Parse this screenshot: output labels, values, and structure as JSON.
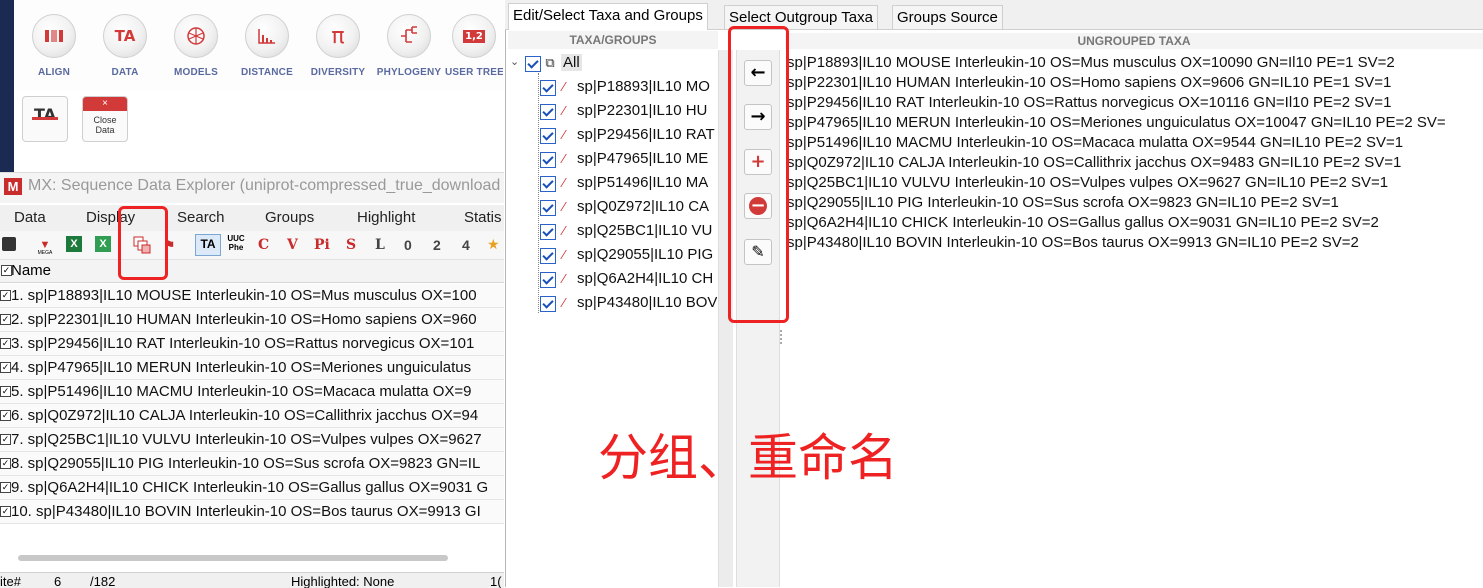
{
  "ribbon": {
    "items": [
      {
        "label": "ALIGN",
        "icon": "align-icon"
      },
      {
        "label": "DATA",
        "icon": "data-icon",
        "glyph": "TA"
      },
      {
        "label": "MODELS",
        "icon": "models-icon"
      },
      {
        "label": "DISTANCE",
        "icon": "distance-icon"
      },
      {
        "label": "DIVERSITY",
        "icon": "diversity-icon",
        "glyph": "π"
      },
      {
        "label": "PHYLOGENY",
        "icon": "phylogeny-icon"
      },
      {
        "label": "USER TREE",
        "icon": "user-tree-icon",
        "glyph": "1,2"
      }
    ],
    "ta_button_glyph": "TA",
    "close_data_label": "Close Data",
    "close_data_top": "×"
  },
  "sequence_explorer": {
    "title": "MX: Sequence Data Explorer (uniprot-compressed_true_download",
    "menu": [
      "Data",
      "Display",
      "Search",
      "Groups",
      "Highlight",
      "Statis"
    ],
    "toolbar_letters": [
      "C",
      "V",
      "Pi",
      "S",
      "L",
      "0",
      "2",
      "4"
    ],
    "toolbar_small_labels": {
      "mega": "MEGA",
      "uuc": "UUC Phe",
      "ta": "TA"
    },
    "column_header": "Name",
    "rows": [
      "1. sp|P18893|IL10 MOUSE Interleukin-10 OS=Mus musculus OX=100",
      "2. sp|P22301|IL10 HUMAN Interleukin-10 OS=Homo sapiens OX=960",
      "3. sp|P29456|IL10 RAT Interleukin-10 OS=Rattus norvegicus OX=101",
      "4. sp|P47965|IL10 MERUN Interleukin-10 OS=Meriones unguiculatus",
      "5. sp|P51496|IL10 MACMU Interleukin-10 OS=Macaca mulatta OX=9",
      "6. sp|Q0Z972|IL10 CALJA Interleukin-10 OS=Callithrix jacchus OX=94",
      "7. sp|Q25BC1|IL10 VULVU Interleukin-10 OS=Vulpes vulpes OX=9627",
      "8. sp|Q29055|IL10 PIG Interleukin-10 OS=Sus scrofa OX=9823 GN=IL",
      "9. sp|Q6A2H4|IL10 CHICK Interleukin-10 OS=Gallus gallus OX=9031 G",
      "10. sp|P43480|IL10 BOVIN Interleukin-10 OS=Bos taurus OX=9913 GI"
    ],
    "status": {
      "site_label": "ite#",
      "site_value": "6",
      "site_total": "/182",
      "highlighted": "Highlighted: None",
      "extra": "1("
    }
  },
  "groups_dialog": {
    "tabs": [
      "Edit/Select Taxa and Groups",
      "Select Outgroup Taxa",
      "Groups Source"
    ],
    "taxa_header": "TAXA/GROUPS",
    "ungrouped_header": "UNGROUPED TAXA",
    "tree_root": "All",
    "tree_items": [
      "sp|P18893|IL10 MO",
      "sp|P22301|IL10 HU",
      "sp|P29456|IL10 RAT",
      "sp|P47965|IL10 ME",
      "sp|P51496|IL10 MA",
      "sp|Q0Z972|IL10 CA",
      "sp|Q25BC1|IL10 VU",
      "sp|Q29055|IL10 PIG",
      "sp|Q6A2H4|IL10 CH",
      "sp|P43480|IL10 BOV"
    ],
    "ungrouped": [
      "sp|P18893|IL10 MOUSE Interleukin-10 OS=Mus musculus OX=10090 GN=Il10 PE=1 SV=2",
      "sp|P22301|IL10 HUMAN Interleukin-10 OS=Homo sapiens OX=9606 GN=IL10 PE=1 SV=1",
      "sp|P29456|IL10 RAT Interleukin-10 OS=Rattus norvegicus OX=10116 GN=Il10 PE=2 SV=1",
      "sp|P47965|IL10 MERUN Interleukin-10 OS=Meriones unguiculatus OX=10047 GN=IL10 PE=2 SV=",
      "sp|P51496|IL10 MACMU Interleukin-10 OS=Macaca mulatta OX=9544 GN=IL10 PE=2 SV=1",
      "sp|Q0Z972|IL10 CALJA Interleukin-10 OS=Callithrix jacchus OX=9483 GN=IL10 PE=2 SV=1",
      "sp|Q25BC1|IL10 VULVU Interleukin-10 OS=Vulpes vulpes OX=9627 GN=IL10 PE=2 SV=1",
      "sp|Q29055|IL10 PIG Interleukin-10 OS=Sus scrofa OX=9823 GN=IL10 PE=2 SV=1",
      "sp|Q6A2H4|IL10 CHICK Interleukin-10 OS=Gallus gallus OX=9031 GN=IL10 PE=2 SV=2",
      "sp|P43480|IL10 BOVIN Interleukin-10 OS=Bos taurus OX=9913 GN=IL10 PE=2 SV=2"
    ],
    "side_buttons": [
      {
        "icon": "arrow-left-icon",
        "glyph": "←"
      },
      {
        "icon": "arrow-right-icon",
        "glyph": "→"
      },
      {
        "icon": "add-icon",
        "glyph": "+"
      },
      {
        "icon": "remove-icon",
        "glyph": "−"
      },
      {
        "icon": "edit-icon",
        "glyph": "✎"
      }
    ]
  },
  "annotation": {
    "text": "分组、重命名",
    "color": "#ee2222"
  }
}
